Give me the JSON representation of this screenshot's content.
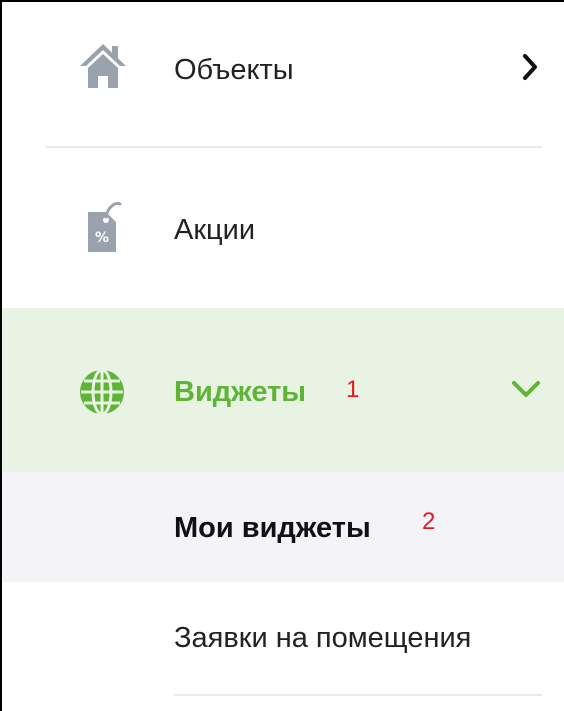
{
  "menu": {
    "objects": {
      "label": "Объекты",
      "icon": "house-icon",
      "chevron": "chevron-right-icon"
    },
    "actions": {
      "label": "Акции",
      "icon": "percent-tag-icon"
    },
    "widgets": {
      "label": "Виджеты",
      "badge": "1",
      "icon": "globe-icon",
      "chevron": "chevron-down-icon",
      "expanded": true
    },
    "submenu": [
      {
        "label": "Мои виджеты",
        "badge": "2",
        "active": true
      },
      {
        "label": "Заявки на помещения"
      }
    ]
  },
  "colors": {
    "accent_green": "#5db435",
    "active_bg": "#e9f3e4",
    "submenu_active_bg": "#f4f3f8",
    "icon_gray": "#9aa3ad",
    "badge_red": "#e8191d",
    "divider": "#e6eaef"
  }
}
